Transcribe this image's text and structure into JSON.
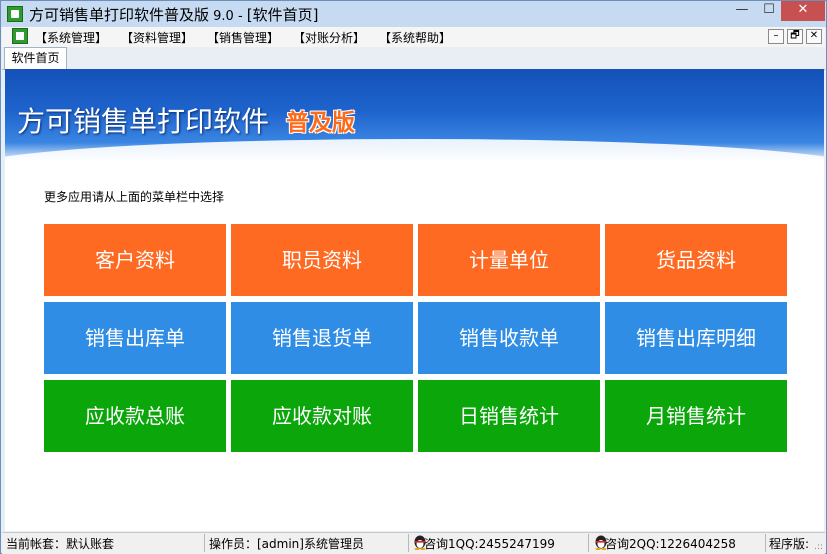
{
  "window": {
    "title": "方可销售单打印软件普及版",
    "version": " 9.0 - ",
    "doc_title": "[软件首页]",
    "min_symbol": "—",
    "max_symbol": "☐",
    "close_symbol": "✕"
  },
  "menu": {
    "items": [
      "【系统管理】",
      "【资料管理】",
      "【销售管理】",
      "【对账分析】",
      "【系统帮助】"
    ],
    "mdi_min": "–",
    "mdi_restore": "🗗",
    "mdi_close": "✕"
  },
  "tabs": [
    "软件首页"
  ],
  "banner": {
    "title": "方可销售单打印软件",
    "edition": "普及版"
  },
  "hint": "更多应用请从上面的菜单栏中选择",
  "tiles": [
    {
      "label": "客户资料",
      "color": "#ff6a22"
    },
    {
      "label": "职员资料",
      "color": "#ff6a22"
    },
    {
      "label": "计量单位",
      "color": "#ff6a22"
    },
    {
      "label": "货品资料",
      "color": "#ff6a22"
    },
    {
      "label": "销售出库单",
      "color": "#2f8de6"
    },
    {
      "label": "销售退货单",
      "color": "#2f8de6"
    },
    {
      "label": "销售收款单",
      "color": "#2f8de6"
    },
    {
      "label": "销售出库明细",
      "color": "#2f8de6"
    },
    {
      "label": "应收款总账",
      "color": "#0aa60a"
    },
    {
      "label": "应收款对账",
      "color": "#0aa60a"
    },
    {
      "label": "日销售统计",
      "color": "#0aa60a"
    },
    {
      "label": "月销售统计",
      "color": "#0aa60a"
    }
  ],
  "status": {
    "account": "当前帐套：默认账套",
    "operator": "操作员：[admin]系统管理员",
    "qq1": "咨询1QQ:2455247199",
    "qq2": "咨询2QQ:1226404258",
    "program": "程序版:",
    "grip": ".::"
  }
}
